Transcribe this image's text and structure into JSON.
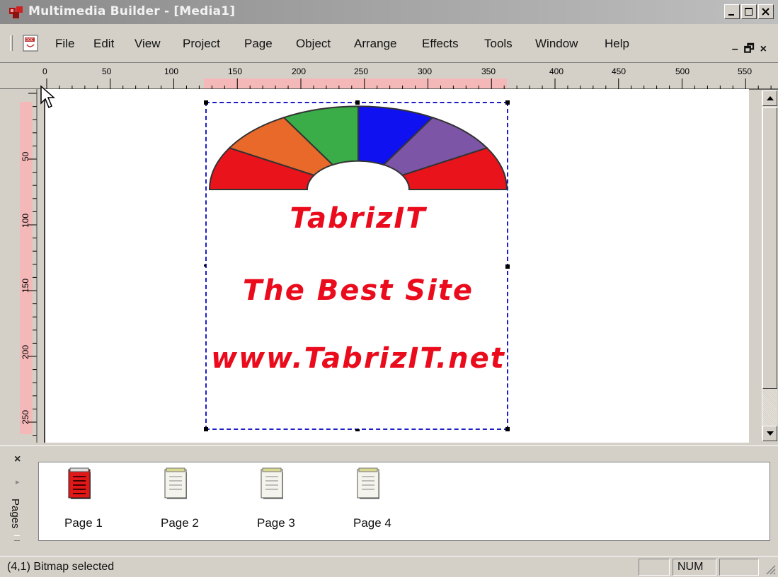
{
  "window": {
    "title": "Multimedia Builder - [Media1]"
  },
  "menu": {
    "items": [
      "File",
      "Edit",
      "View",
      "Project",
      "Page",
      "Object",
      "Arrange",
      "Effects",
      "Tools",
      "Window",
      "Help"
    ]
  },
  "ruler": {
    "h_ticks": [
      "0",
      "50",
      "100",
      "150",
      "200",
      "250",
      "300",
      "350",
      "400",
      "450",
      "500",
      "550"
    ],
    "v_ticks": [
      "50",
      "100",
      "150",
      "200",
      "250"
    ]
  },
  "bitmap": {
    "line1": "TabrizIT",
    "line2": "The Best Site",
    "line3": "www.TabrizIT.net",
    "arc_colors": [
      "#e8131b",
      "#e8692a",
      "#3aac48",
      "#0f11f0",
      "#7d55a6",
      "#e8131b"
    ]
  },
  "pages_panel": {
    "title": "Pages",
    "pages": [
      "Page 1",
      "Page 2",
      "Page 3",
      "Page 4"
    ],
    "active_page": "Page 1"
  },
  "status": {
    "message": "(4,1)  Bitmap selected",
    "num": "NUM"
  }
}
